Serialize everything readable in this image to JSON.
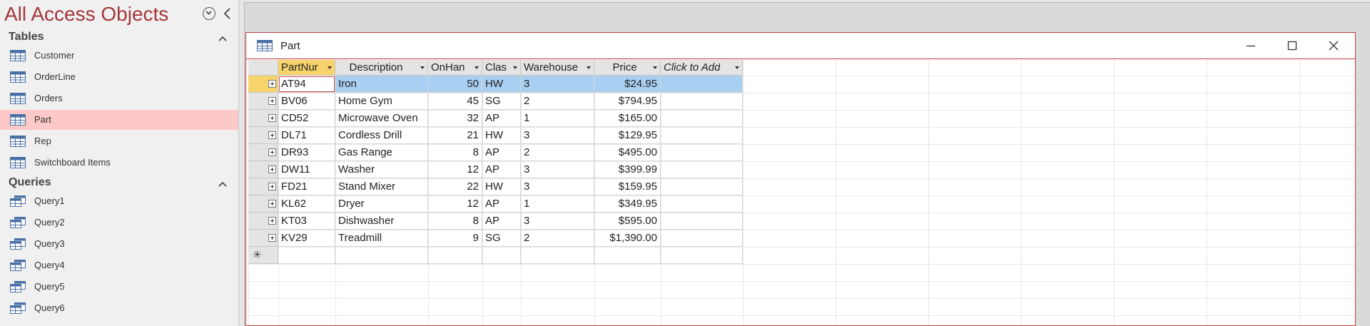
{
  "nav": {
    "title": "All Access Objects",
    "groups": {
      "tables": {
        "label": "Tables",
        "items": [
          {
            "label": "Customer"
          },
          {
            "label": "OrderLine"
          },
          {
            "label": "Orders"
          },
          {
            "label": "Part",
            "selected": true
          },
          {
            "label": "Rep"
          },
          {
            "label": "Switchboard Items"
          }
        ]
      },
      "queries": {
        "label": "Queries",
        "items": [
          {
            "label": "Query1"
          },
          {
            "label": "Query2"
          },
          {
            "label": "Query3"
          },
          {
            "label": "Query4"
          },
          {
            "label": "Query5"
          },
          {
            "label": "Query6"
          }
        ]
      }
    }
  },
  "document": {
    "title": "Part",
    "window_buttons": {
      "minimize": "minimize-icon",
      "maximize": "maximize-icon",
      "close": "close-icon"
    }
  },
  "datasheet": {
    "columns": [
      {
        "label": "PartNur",
        "active": true
      },
      {
        "label": "Description"
      },
      {
        "label": "OnHan"
      },
      {
        "label": "Clas"
      },
      {
        "label": "Warehouse"
      },
      {
        "label": "Price"
      },
      {
        "label": "Click to Add"
      }
    ],
    "rows": [
      [
        "AT94",
        "Iron",
        "50",
        "HW",
        "3",
        "$24.95"
      ],
      [
        "BV06",
        "Home Gym",
        "45",
        "SG",
        "2",
        "$794.95"
      ],
      [
        "CD52",
        "Microwave Oven",
        "32",
        "AP",
        "1",
        "$165.00"
      ],
      [
        "DL71",
        "Cordless Drill",
        "21",
        "HW",
        "3",
        "$129.95"
      ],
      [
        "DR93",
        "Gas Range",
        "8",
        "AP",
        "2",
        "$495.00"
      ],
      [
        "DW11",
        "Washer",
        "12",
        "AP",
        "3",
        "$399.99"
      ],
      [
        "FD21",
        "Stand Mixer",
        "22",
        "HW",
        "3",
        "$159.95"
      ],
      [
        "KL62",
        "Dryer",
        "12",
        "AP",
        "1",
        "$349.95"
      ],
      [
        "KT03",
        "Dishwasher",
        "8",
        "AP",
        "3",
        "$595.00"
      ],
      [
        "KV29",
        "Treadmill",
        "9",
        "SG",
        "2",
        "$1,390.00"
      ]
    ],
    "current_row": 0,
    "new_record_symbol": "✳"
  },
  "colors": {
    "title_accent": "#a4373a",
    "selected_nav_item": "#fcc8c8",
    "active_header": "#f7d36b",
    "current_row": "#a9cff2",
    "window_border": "#c23b3b"
  }
}
